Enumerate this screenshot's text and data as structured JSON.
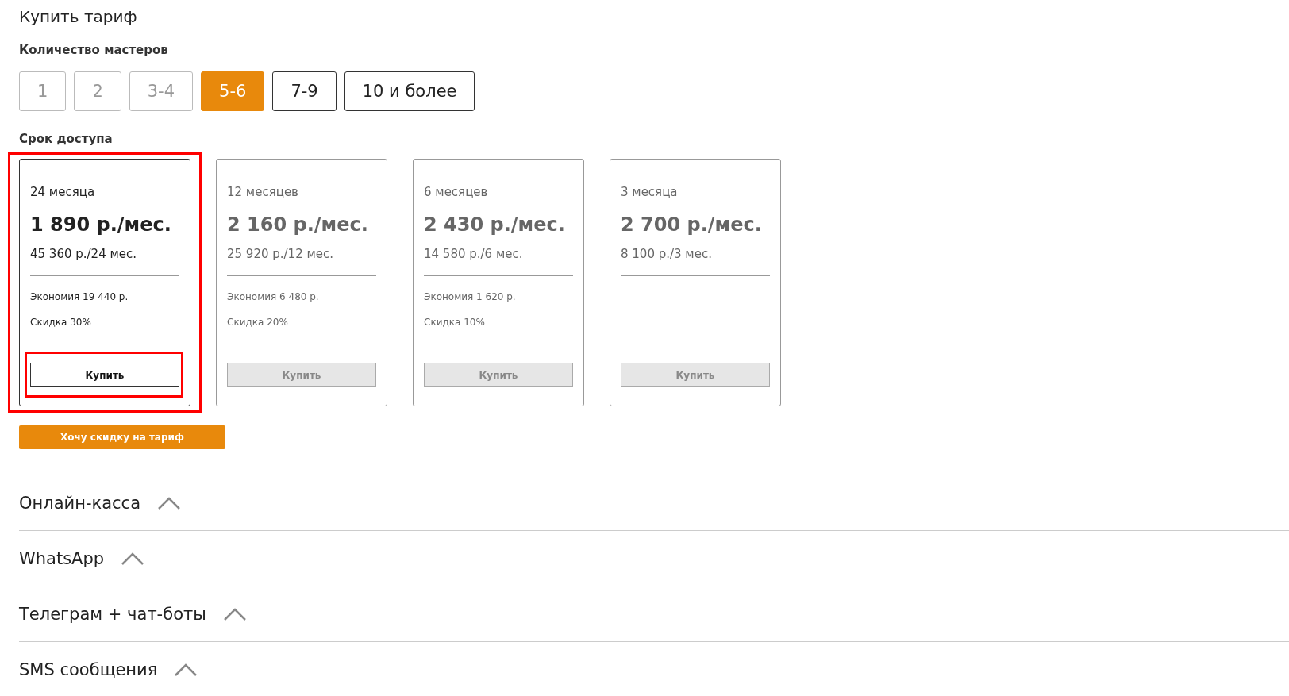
{
  "title": "Купить тариф",
  "masters": {
    "label": "Количество мастеров",
    "options": [
      {
        "label": "1",
        "selected": false,
        "disabled": true
      },
      {
        "label": "2",
        "selected": false,
        "disabled": true
      },
      {
        "label": "3-4",
        "selected": false,
        "disabled": true
      },
      {
        "label": "5-6",
        "selected": true,
        "disabled": false
      },
      {
        "label": "7-9",
        "selected": false,
        "disabled": false
      },
      {
        "label": "10 и более",
        "selected": false,
        "disabled": false
      }
    ]
  },
  "period": {
    "label": "Срок доступа",
    "cards": [
      {
        "period": "24 месяца",
        "price": "1 890 р./мес.",
        "total": "45 360 р./24 мес.",
        "savings": "Экономия 19 440 р.",
        "discount": "Скидка 30%",
        "button": "Купить",
        "selected": true,
        "highlighted": true,
        "button_highlighted": true
      },
      {
        "period": "12 месяцев",
        "price": "2 160 р./мес.",
        "total": "25 920 р./12 мес.",
        "savings": "Экономия 6 480 р.",
        "discount": "Скидка 20%",
        "button": "Купить",
        "selected": false,
        "highlighted": false,
        "button_highlighted": false
      },
      {
        "period": "6 месяцев",
        "price": "2 430 р./мес.",
        "total": "14 580 р./6 мес.",
        "savings": "Экономия 1 620 р.",
        "discount": "Скидка 10%",
        "button": "Купить",
        "selected": false,
        "highlighted": false,
        "button_highlighted": false
      },
      {
        "period": "3 месяца",
        "price": "2 700 р./мес.",
        "total": "8 100 р./3 мес.",
        "button": "Купить",
        "selected": false,
        "highlighted": false,
        "button_highlighted": false
      }
    ]
  },
  "discount_button": "Хочу скидку на тариф",
  "sections": [
    {
      "title": "Онлайн-касса"
    },
    {
      "title": "WhatsApp"
    },
    {
      "title": "Телеграм + чат-боты"
    },
    {
      "title": "SMS сообщения"
    }
  ]
}
